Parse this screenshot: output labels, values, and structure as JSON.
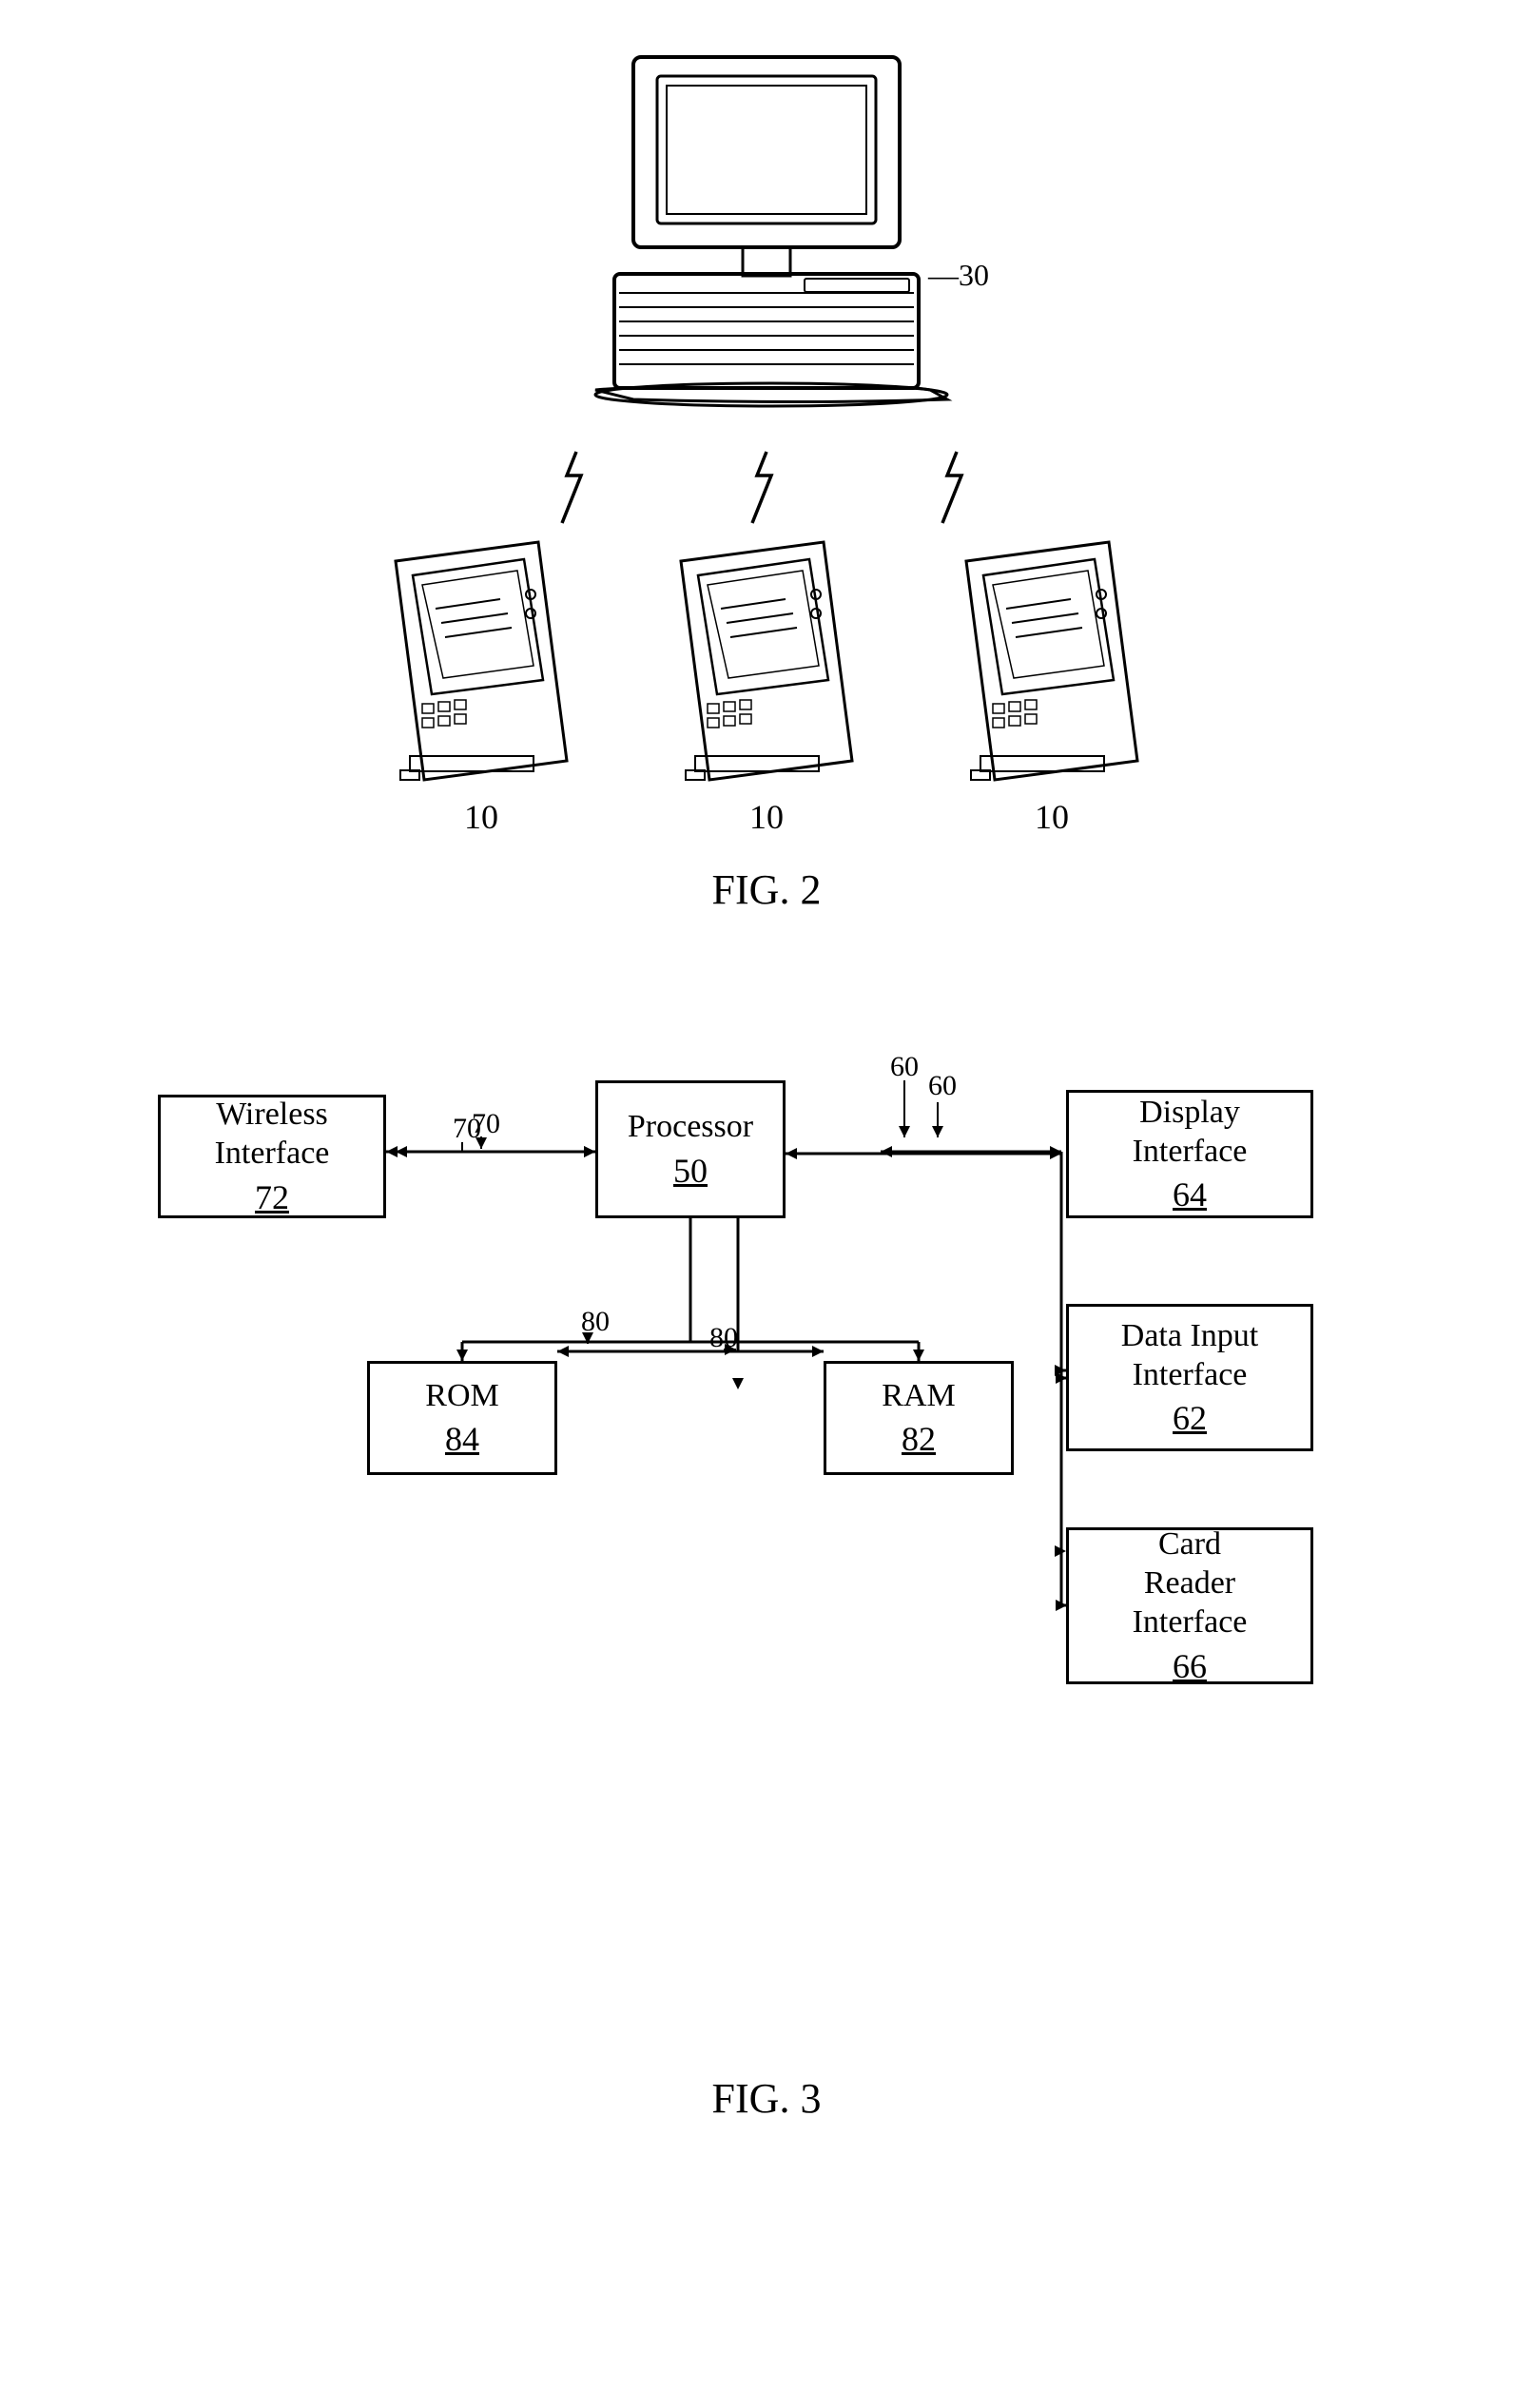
{
  "fig2": {
    "label": "FIG. 2",
    "computer_ref": "30",
    "device_labels": [
      "10",
      "10",
      "10"
    ]
  },
  "fig3": {
    "label": "FIG. 3",
    "blocks": {
      "wireless": {
        "title": "Wireless\nInterface",
        "number": "72",
        "ref": "70"
      },
      "processor": {
        "title": "Processor",
        "number": "50",
        "ref": "60"
      },
      "rom": {
        "title": "ROM",
        "number": "84",
        "ref": "80"
      },
      "ram": {
        "title": "RAM",
        "number": "82"
      },
      "display": {
        "title": "Display\nInterface",
        "number": "64"
      },
      "data_input": {
        "title": "Data Input\nInterface",
        "number": "62"
      },
      "card_reader": {
        "title": "Card\nReader\nInterface",
        "number": "66"
      }
    },
    "ref_labels": {
      "r60": "60",
      "r70": "70",
      "r80": "80"
    }
  }
}
